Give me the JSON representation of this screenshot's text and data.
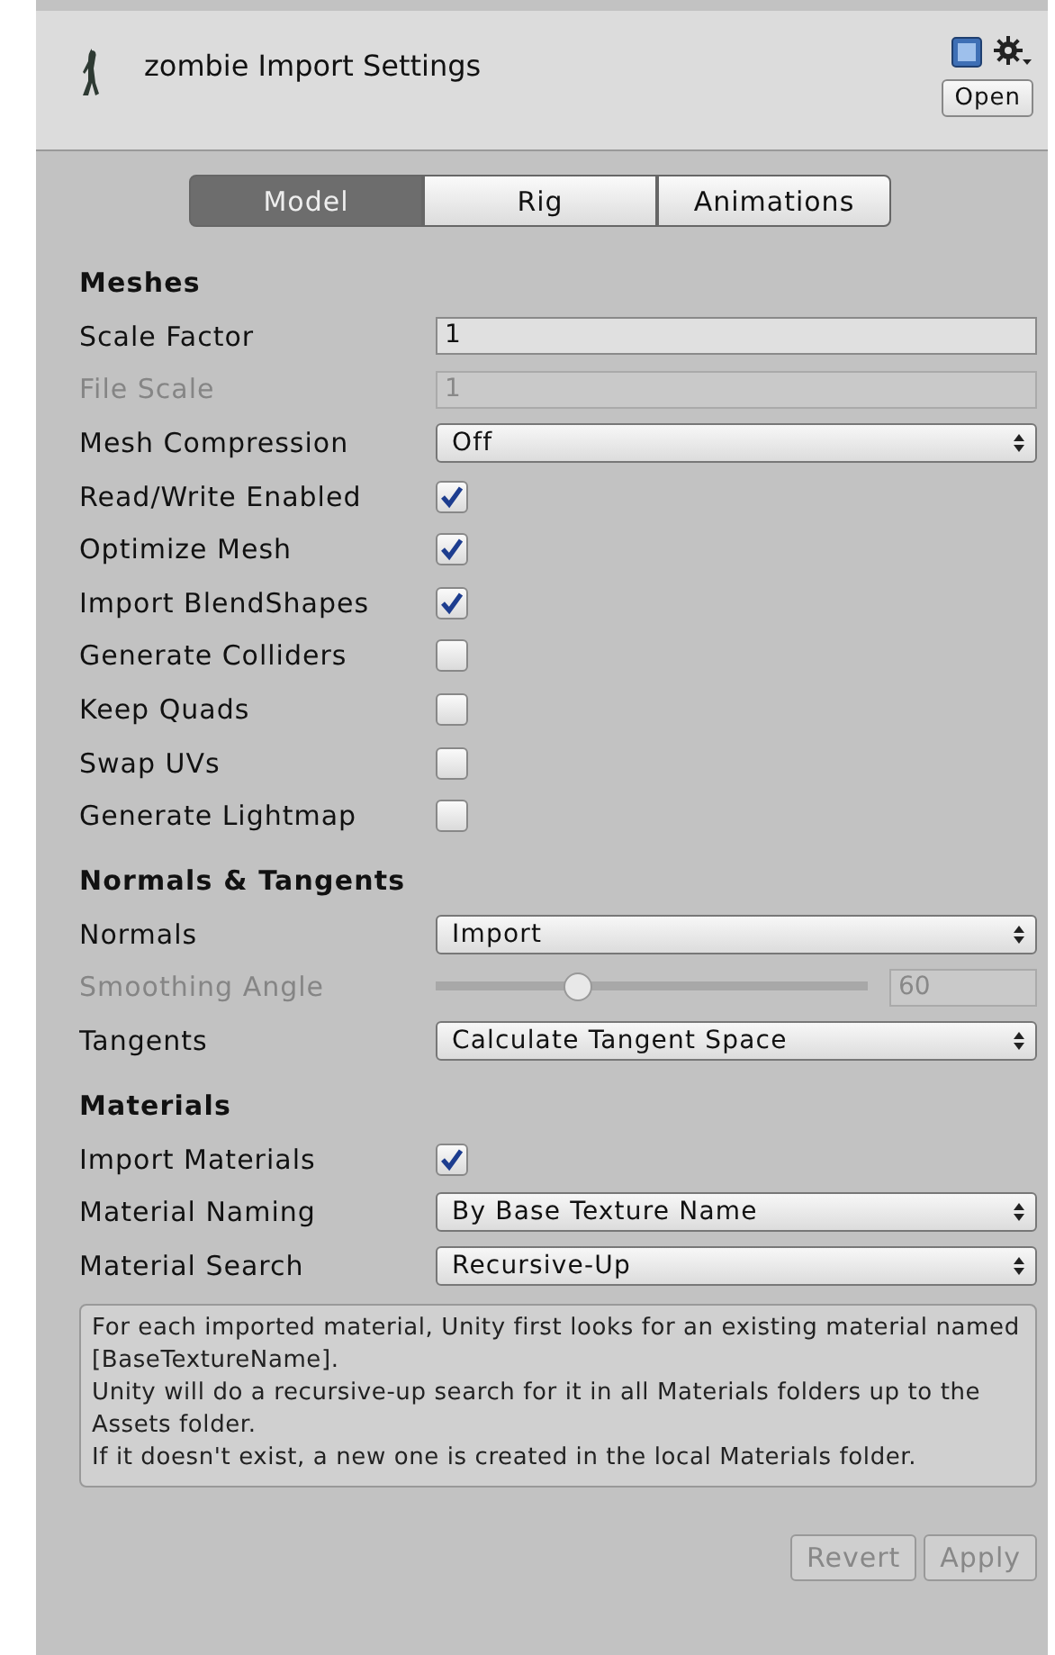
{
  "header": {
    "title": "zombie Import Settings",
    "open_button": "Open"
  },
  "tabs": [
    {
      "label": "Model",
      "selected": true
    },
    {
      "label": "Rig",
      "selected": false
    },
    {
      "label": "Animations",
      "selected": false
    }
  ],
  "sections": [
    {
      "heading": "Meshes",
      "rows": [
        {
          "kind": "field",
          "label": "Scale Factor",
          "value": "1",
          "disabled": false
        },
        {
          "kind": "field",
          "label": "File Scale",
          "value": "1",
          "disabled": true
        },
        {
          "kind": "dropdown",
          "label": "Mesh Compression",
          "value": "Off",
          "disabled": false
        },
        {
          "kind": "checkbox",
          "label": "Read/Write Enabled",
          "checked": true,
          "disabled": false
        },
        {
          "kind": "checkbox",
          "label": "Optimize Mesh",
          "checked": true,
          "disabled": false
        },
        {
          "kind": "checkbox",
          "label": "Import BlendShapes",
          "checked": true,
          "disabled": false
        },
        {
          "kind": "checkbox",
          "label": "Generate Colliders",
          "checked": false,
          "disabled": false
        },
        {
          "kind": "checkbox",
          "label": "Keep Quads",
          "checked": false,
          "disabled": false
        },
        {
          "kind": "checkbox",
          "label": "Swap UVs",
          "checked": false,
          "disabled": false
        },
        {
          "kind": "checkbox",
          "label": "Generate Lightmap",
          "checked": false,
          "disabled": false
        }
      ]
    },
    {
      "heading": "Normals & Tangents",
      "rows": [
        {
          "kind": "dropdown",
          "label": "Normals",
          "value": "Import",
          "disabled": false
        },
        {
          "kind": "slider",
          "label": "Smoothing Angle",
          "level": 0.33,
          "value": "60",
          "disabled": true
        },
        {
          "kind": "dropdown",
          "label": "Tangents",
          "value": "Calculate Tangent Space",
          "disabled": false
        }
      ]
    },
    {
      "heading": "Materials",
      "rows": [
        {
          "kind": "checkbox",
          "label": "Import Materials",
          "checked": true,
          "disabled": false
        },
        {
          "kind": "dropdown",
          "label": "Material Naming",
          "value": "By Base Texture Name",
          "disabled": false
        },
        {
          "kind": "dropdown",
          "label": "Material Search",
          "value": "Recursive-Up",
          "disabled": false
        }
      ]
    }
  ],
  "help_text": [
    "For each imported material, Unity first looks for an existing material named [BaseTextureName].",
    "Unity will do a recursive-up search for it in all Materials folders up to the Assets folder.",
    "If it doesn't exist, a new one is created in the local Materials folder."
  ],
  "footer_buttons": [
    {
      "label": "Revert",
      "disabled": true
    },
    {
      "label": "Apply",
      "disabled": true
    }
  ]
}
